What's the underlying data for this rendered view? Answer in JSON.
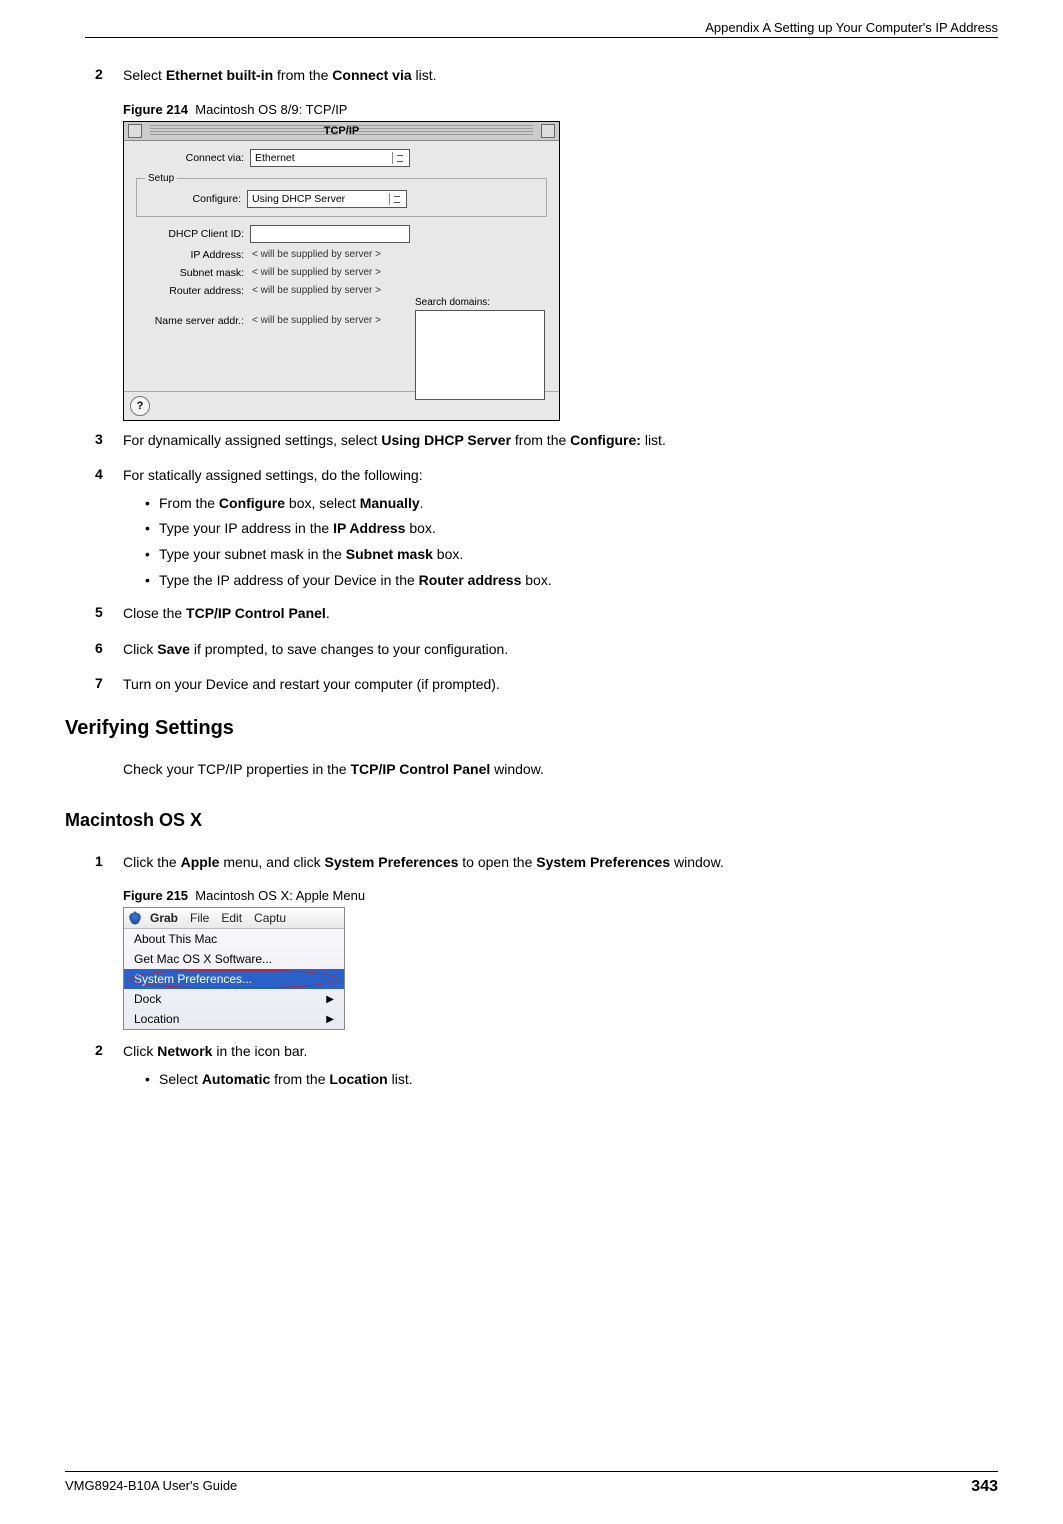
{
  "header": {
    "appendix": "Appendix A Setting up Your Computer's IP Address"
  },
  "steps_a": {
    "s2": {
      "num": "2",
      "pre": "Select ",
      "b1": "Ethernet built-in",
      "mid": " from the ",
      "b2": "Connect via",
      "post": " list."
    },
    "s3": {
      "num": "3",
      "pre": "For dynamically assigned settings, select ",
      "b1": "Using DHCP Server",
      "mid": " from the ",
      "b2": "Configure:",
      "post": " list."
    },
    "s4": {
      "num": "4",
      "text": "For statically assigned settings, do the following:"
    },
    "s5": {
      "num": "5",
      "pre": "Close the ",
      "b1": "TCP/IP Control Panel",
      "post": "."
    },
    "s6": {
      "num": "6",
      "pre": "Click ",
      "b1": "Save",
      "post": " if prompted, to save changes to your configuration."
    },
    "s7": {
      "num": "7",
      "text": "Turn on your Device and restart your computer (if prompted)."
    }
  },
  "bullets4": {
    "a": {
      "pre": "From the ",
      "b1": "Configure",
      "mid": " box, select ",
      "b2": "Manually",
      "post": "."
    },
    "b": {
      "pre": "Type your IP address in the ",
      "b1": "IP Address",
      "post": " box."
    },
    "c": {
      "pre": "Type your subnet mask in the ",
      "b1": "Subnet mask",
      "post": " box."
    },
    "d": {
      "pre": "Type the IP address of your Device in the ",
      "b1": "Router address",
      "post": " box."
    }
  },
  "fig214": {
    "caption_num": "Figure 214",
    "caption_text": "Macintosh OS 8/9: TCP/IP",
    "window_title": "TCP/IP",
    "labels": {
      "connect_via": "Connect via:",
      "setup": "Setup",
      "configure": "Configure:",
      "dhcp_client": "DHCP Client ID:",
      "ip": "IP Address:",
      "subnet": "Subnet mask:",
      "router": "Router address:",
      "ns": "Name server addr.:",
      "search": "Search domains:"
    },
    "values": {
      "connect_via": "Ethernet",
      "configure": "Using DHCP Server",
      "dhcp_client": "",
      "supplied": "< will be supplied by server >"
    },
    "help": "?"
  },
  "verify": {
    "heading": "Verifying Settings",
    "text_pre": "Check your TCP/IP properties in the ",
    "text_b": "TCP/IP Control Panel",
    "text_post": " window."
  },
  "osx": {
    "heading": "Macintosh OS X",
    "s1": {
      "num": "1",
      "pre": "Click the ",
      "b1": "Apple",
      "mid1": " menu, and click ",
      "b2": "System Preferences",
      "mid2": " to open the ",
      "b3": "System Preferences",
      "post": " window."
    },
    "s2": {
      "num": "2",
      "pre": "Click ",
      "b1": "Network",
      "post": " in the icon bar."
    },
    "s2a": {
      "pre": "Select ",
      "b1": "Automatic",
      "mid": " from the ",
      "b2": "Location",
      "post": " list."
    }
  },
  "fig215": {
    "caption_num": "Figure 215",
    "caption_text": "Macintosh OS X: Apple Menu",
    "menubar": {
      "grab": "Grab",
      "file": "File",
      "edit": "Edit",
      "captu": "Captu"
    },
    "items": {
      "about": "About This Mac",
      "getsw": "Get Mac OS X Software...",
      "sysprefs": "System Preferences...",
      "dock": "Dock",
      "location": "Location"
    },
    "arrow": "▶"
  },
  "footer": {
    "guide": "VMG8924-B10A User's Guide",
    "page": "343"
  }
}
